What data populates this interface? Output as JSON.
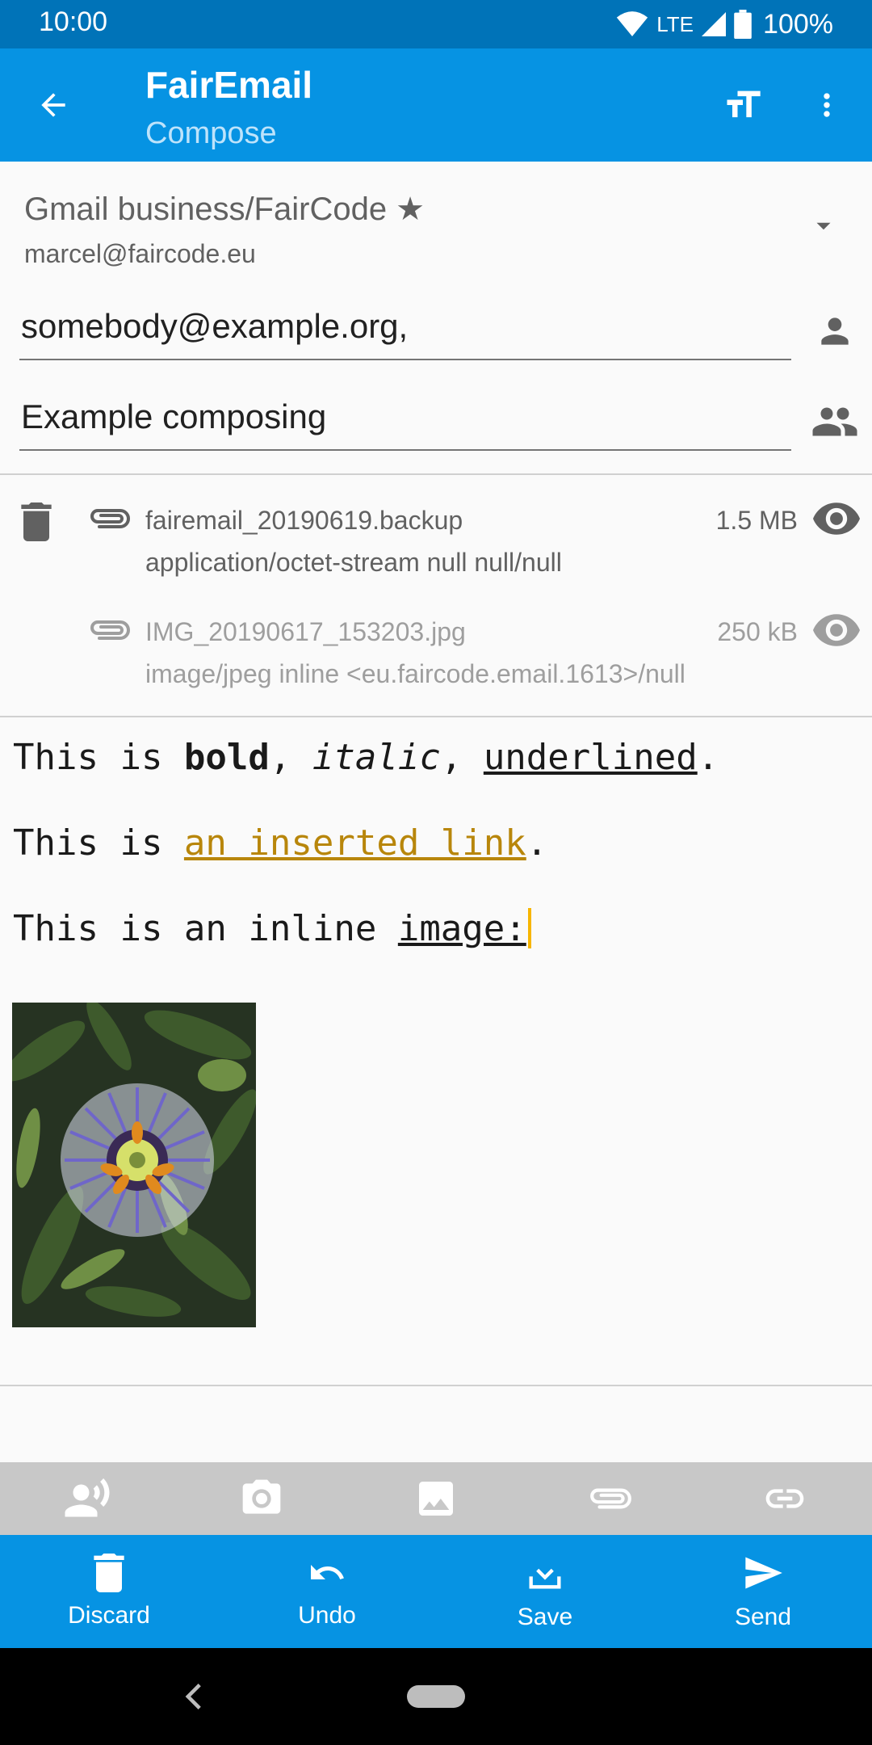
{
  "status_bar": {
    "time": "10:00",
    "network": "LTE",
    "battery": "100%"
  },
  "app_bar": {
    "title": "FairEmail",
    "subtitle": "Compose"
  },
  "identity": {
    "name": "Gmail business/FairCode ★",
    "email": "marcel@faircode.eu"
  },
  "to": {
    "value": "somebody@example.org,"
  },
  "subject": {
    "value": "Example composing"
  },
  "attachments": [
    {
      "name": "fairemail_20190619.backup",
      "size": "1.5 MB",
      "type": "application/octet-stream null null/null"
    },
    {
      "name": "IMG_20190617_153203.jpg",
      "size": "250 kB",
      "type": "image/jpeg inline <eu.faircode.email.1613>/null"
    }
  ],
  "body": {
    "line1": {
      "prefix": "This is ",
      "bold": "bold",
      "sep1": ", ",
      "italic": "italic",
      "sep2": ", ",
      "underlined": "underlined",
      "end": "."
    },
    "line2": {
      "prefix": "This is ",
      "link": "an inserted link",
      "end": "."
    },
    "line3": {
      "prefix": "This is an inline ",
      "underlined": "image:"
    }
  },
  "actions": {
    "discard": "Discard",
    "undo": "Undo",
    "save": "Save",
    "send": "Send"
  },
  "colors": {
    "primary": "#0693e3",
    "primary_dark": "#0073b8",
    "link": "#b8860b",
    "cursor": "#f7b500"
  }
}
